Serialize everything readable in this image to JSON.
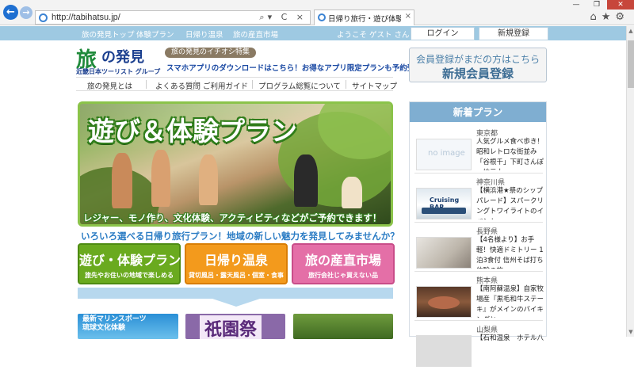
{
  "browser": {
    "url": "http://tabihatsu.jp/",
    "tab_title": "日帰り旅行・遊び体験プラン・...",
    "address_icons": "⌕▾ C ×",
    "tab_close": "×",
    "window_buttons": [
      "—",
      "❐",
      "✕"
    ],
    "tools": "⌂★⚙"
  },
  "topbar": {
    "links": [
      "旅の発見トップ",
      "体験プラン",
      "日帰り温泉",
      "旅の産直市場"
    ],
    "welcome": "ようこそ ゲスト さん",
    "login": "ログイン",
    "register": "新規登録"
  },
  "header": {
    "logo_mark": "旅",
    "logo_text": "の発見",
    "logo_sub": "近畿日本ツーリスト グループ",
    "feature_tag": "旅の発見のイチオシ特集",
    "feature_text": "スマホアプリのダウンロードはこちら！お得なアプリ限定プランも予約受付中",
    "signup_line1": "会員登録がまだの方はこちら",
    "signup_line2": "新規会員登録"
  },
  "nav": [
    "旅の発見とは",
    "よくある質問",
    "ご利用ガイド",
    "プログラム総覧について",
    "サイトマップ"
  ],
  "hero": {
    "title": "遊び＆体験プラン",
    "subtitle": "レジャー、モノ作り、文化体験、アクティビティなどがご予約できます！"
  },
  "tagline": "いろいろ選べる日帰り旅行プラン！地域の新しい魅力を発見してみませんか？",
  "categories": [
    {
      "title": "遊び・体験プラン",
      "sub": "旅先やお住いの地域で楽しめる"
    },
    {
      "title": "日帰り温泉",
      "sub": "貸切風呂・露天風呂・個室・食事"
    },
    {
      "title": "旅の産直市場",
      "sub": "旅行会社じゃ買えない品"
    }
  ],
  "thumbs": {
    "t1": "最新マリンスポーツ\n琉球文化体験",
    "t2": "祇園祭"
  },
  "sidebar": {
    "heading": "新着プラン",
    "plans": [
      {
        "pref": "東京都",
        "title": "人気グルメ食べ歩き！昭和レトロな街並み「谷根千」下町さんぽ～地元士",
        "thumb": "no image"
      },
      {
        "pref": "神奈川県",
        "title": "【横浜港★祭のシップパレード】スパークリングトワイライトのイベント",
        "thumb": "Cruising BAR"
      },
      {
        "pref": "長野県",
        "title": "【4名様より】お手軽！快適ドミトリー 1泊3食付 信州そば打ち体験の旅",
        "thumb": ""
      },
      {
        "pref": "熊本県",
        "title": "【南阿蘇温泉】自家牧場産『黒毛和牛ステーキ』がメインのバイキングと",
        "thumb": ""
      },
      {
        "pref": "山梨県",
        "title": "【石和温泉　ホテル八",
        "thumb": ""
      }
    ]
  }
}
